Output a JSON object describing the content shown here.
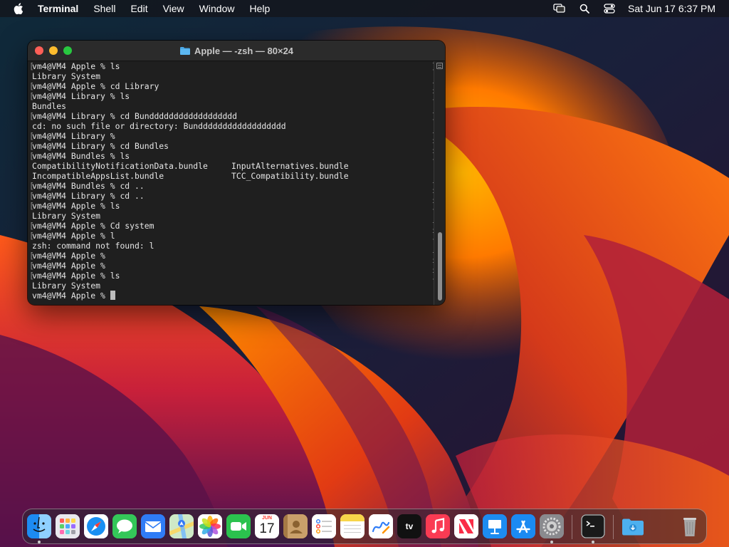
{
  "menubar": {
    "app_name": "Terminal",
    "menus": [
      "Shell",
      "Edit",
      "View",
      "Window",
      "Help"
    ],
    "clock": "Sat Jun 17  6:37 PM",
    "status_icons": [
      "screen-mirroring-icon",
      "spotlight-search-icon",
      "control-center-icon"
    ]
  },
  "terminal": {
    "title": "Apple — -zsh — 80×24",
    "lines": [
      "vm4@VM4 Apple % ls",
      "Library System",
      "vm4@VM4 Apple % cd Library",
      "vm4@VM4 Library % ls",
      "Bundles",
      "vm4@VM4 Library % cd Bundddddddddddddddddd",
      "cd: no such file or directory: Bundddddddddddddddddd",
      "vm4@VM4 Library %",
      "vm4@VM4 Library % cd Bundles",
      "vm4@VM4 Bundles % ls",
      "CompatibilityNotificationData.bundle",
      "IncompatibleAppsList.bundle",
      "vm4@VM4 Bundles % cd ..",
      "vm4@VM4 Library % cd ..",
      "vm4@VM4 Apple % ls",
      "Library System",
      "vm4@VM4 Apple % Cd system",
      "vm4@VM4 Apple % l",
      "zsh: command not found: l",
      "vm4@VM4 Apple %",
      "vm4@VM4 Apple %",
      "vm4@VM4 Apple % ls",
      "Library System",
      "vm4@VM4 Apple % "
    ],
    "column2": {
      "10": "InputAlternatives.bundle",
      "11": "TCC_Compatibility.bundle"
    }
  },
  "dock": {
    "calendar_month": "JUN",
    "calendar_day": "17",
    "tv_label": "tv",
    "items": [
      {
        "name": "finder-icon",
        "color": "#1e8ef5"
      },
      {
        "name": "launchpad-icon",
        "color": "#d8d8d8"
      },
      {
        "name": "safari-icon",
        "color": "#1a8ff2"
      },
      {
        "name": "messages-icon",
        "color": "#34c759"
      },
      {
        "name": "mail-icon",
        "color": "#2f7cf6"
      },
      {
        "name": "maps-icon",
        "color": "#64b85c"
      },
      {
        "name": "photos-icon",
        "color": "#ffffff"
      },
      {
        "name": "facetime-icon",
        "color": "#2bc24e"
      },
      {
        "name": "calendar-icon",
        "color": "#ffffff"
      },
      {
        "name": "contacts-icon",
        "color": "#b58a55"
      },
      {
        "name": "reminders-icon",
        "color": "#ffffff"
      },
      {
        "name": "notes-icon",
        "color": "#f7d54a"
      },
      {
        "name": "freeform-icon",
        "color": "#ffffff"
      },
      {
        "name": "apple-tv-icon",
        "color": "#111111"
      },
      {
        "name": "music-icon",
        "color": "#fa3b53"
      },
      {
        "name": "news-icon",
        "color": "#ffffff"
      },
      {
        "name": "keynote-icon",
        "color": "#1d8cf0"
      },
      {
        "name": "app-store-icon",
        "color": "#1b8af2"
      },
      {
        "name": "system-settings-icon",
        "color": "#8a8a8e"
      },
      {
        "name": "terminal-icon",
        "color": "#1a1a1a"
      },
      {
        "name": "downloads-folder-icon",
        "color": "#4db0ef"
      },
      {
        "name": "trash-icon",
        "color": "#9a9a9a"
      }
    ]
  }
}
